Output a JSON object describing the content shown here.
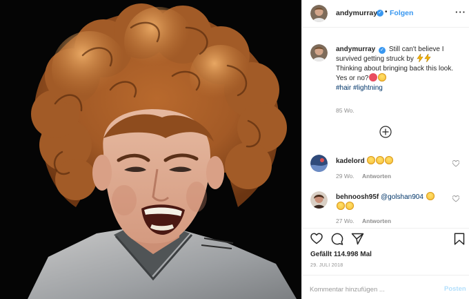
{
  "post": {
    "photo_alt": "",
    "header": {
      "username": "andymurray",
      "separator": "•",
      "follow_label": "Folgen",
      "more_label": "···"
    },
    "caption": {
      "username": "andymurray",
      "text_line1": "Still can't believe I survived getting struck by",
      "text_line2": "Thinking about bringing back this look.",
      "text_line3": "Yes or no?",
      "hashtag1": "#hair",
      "hashtag2": "#lightning",
      "timestamp": "85 Wo."
    },
    "comments": [
      {
        "username": "kadelord",
        "text": "",
        "timestamp": "29 Wo.",
        "reply_label": "Antworten"
      },
      {
        "username": "behnoosh95f",
        "mention": "@golshan904",
        "timestamp": "27 Wo.",
        "reply_label": "Antworten"
      }
    ],
    "likes_text": "Gefällt 114.998 Mal",
    "date": "29. JULI 2018",
    "comment_placeholder": "Kommentar hinzufügen ...",
    "post_label": "Posten"
  },
  "icons": {
    "heart": "heart-icon",
    "comment": "comment-icon",
    "share": "share-icon",
    "bookmark": "bookmark-icon",
    "add": "plus-circle-icon",
    "verified": "verified-badge-icon"
  },
  "colors": {
    "link_blue": "#3897f0",
    "hashtag": "#003569",
    "muted": "#8e8e8e",
    "post_disabled": "#b2dffc"
  }
}
